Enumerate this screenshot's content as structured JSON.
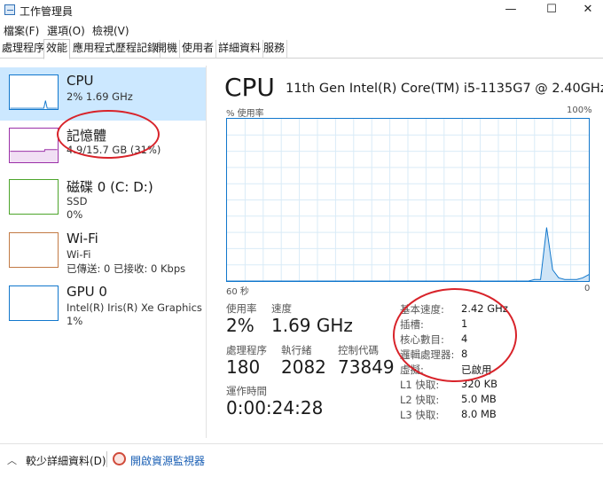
{
  "window": {
    "title": "工作管理員",
    "minimize_glyph": "—",
    "maximize_glyph": "☐",
    "close_glyph": "✕"
  },
  "menu": [
    "檔案(F)",
    "選項(O)",
    "檢視(V)"
  ],
  "tabs": [
    "處理程序",
    "效能",
    "應用程式歷程記錄",
    "開機",
    "使用者",
    "詳細資料",
    "服務"
  ],
  "sidebar": {
    "items": [
      {
        "title": "CPU",
        "lines": [
          "2% 1.69 GHz"
        ],
        "color": "#1177cc"
      },
      {
        "title": "記憶體",
        "lines": [
          "4.9/15.7 GB (31%)"
        ],
        "color": "#9b30a8"
      },
      {
        "title": "磁碟 0 (C: D:)",
        "lines": [
          "SSD",
          "0%"
        ],
        "color": "#4da52b"
      },
      {
        "title": "Wi-Fi",
        "lines": [
          "Wi-Fi",
          "已傳送: 0 已接收: 0 Kbps"
        ],
        "color": "#c27a45"
      },
      {
        "title": "GPU 0",
        "lines": [
          "Intel(R) Iris(R) Xe Graphics",
          "1%"
        ],
        "color": "#1177cc"
      }
    ]
  },
  "main": {
    "title": "CPU",
    "model": "11th Gen Intel(R) Core(TM) i5-1135G7 @ 2.40GHz",
    "graph": {
      "y_label": "% 使用率",
      "y_max_label": "100%",
      "x_left_label": "60 秒",
      "x_right_label": "0",
      "usage_series": [
        0,
        0,
        0,
        0,
        0,
        0,
        0,
        0,
        0,
        0,
        0,
        0,
        0,
        0,
        0,
        0,
        0,
        0,
        0,
        0,
        0,
        0,
        0,
        0,
        0,
        0,
        0,
        0,
        0,
        0,
        0,
        0,
        0,
        0,
        0,
        0,
        0,
        0,
        0,
        0,
        0,
        0,
        0,
        0,
        0,
        0,
        0,
        0,
        0,
        0,
        0,
        1,
        1,
        33,
        7,
        2,
        1,
        1,
        1,
        2,
        4
      ]
    },
    "stats": {
      "usage_label": "使用率",
      "usage_value": "2%",
      "speed_label": "速度",
      "speed_value": "1.69 GHz",
      "processes_label": "處理程序",
      "processes_value": "180",
      "threads_label": "執行緒",
      "threads_value": "2082",
      "handles_label": "控制代碼",
      "handles_value": "73849",
      "uptime_label": "運作時間",
      "uptime_value": "0:00:24:28"
    },
    "specs": [
      {
        "label": "基本速度:",
        "value": "2.42 GHz"
      },
      {
        "label": "插槽:",
        "value": "1"
      },
      {
        "label": "核心數目:",
        "value": "4"
      },
      {
        "label": "邏輯處理器:",
        "value": "8"
      },
      {
        "label": "虛擬:",
        "value": "已啟用"
      },
      {
        "label": "L1 快取:",
        "value": "320 KB"
      },
      {
        "label": "L2 快取:",
        "value": "5.0 MB"
      },
      {
        "label": "L3 快取:",
        "value": "8.0 MB"
      }
    ]
  },
  "footer": {
    "fewer_details": "較少詳細資料(D)",
    "open_monitor": "開啟資源監視器"
  },
  "colors": {
    "accent": "#1177cc",
    "selected_bg": "#cce8ff",
    "annotation": "#d8232a"
  }
}
